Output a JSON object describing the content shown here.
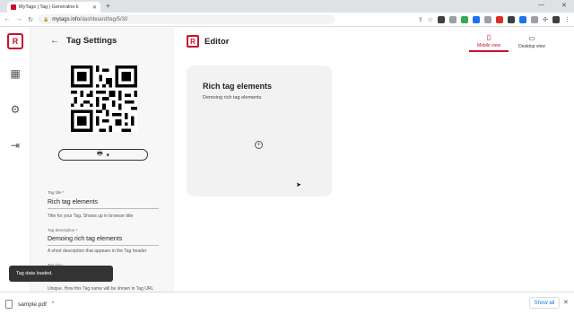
{
  "browser": {
    "tab_title": "MyTags | Tag | Generalne k",
    "new_tab": "+",
    "url_host": "mytags.info",
    "url_path": "/dashboard/tag/5/30",
    "back": "←",
    "forward": "→",
    "reload": "↻",
    "lock": "🔒",
    "minimize": "—",
    "close": "✕"
  },
  "rail": {
    "logo_glyph": "R",
    "icons": [
      "grid-icon",
      "gear-icon",
      "logout-icon"
    ]
  },
  "settings": {
    "back_arrow": "←",
    "heading": "Tag Settings",
    "print_glyph": "🖶",
    "print_caret": "▾",
    "fields": [
      {
        "label": "Tag title *",
        "value": "Rich tag elements",
        "help": "Title for your Tag. Shows up in browser title"
      },
      {
        "label": "Tag description *",
        "value": "Demoing rich tag elements",
        "help": "A short description that appears in the Tag header"
      },
      {
        "label": "Tag slug",
        "value": "",
        "help": "Unique. How this Tag name will be shown in Tag URL"
      }
    ]
  },
  "editor": {
    "logo_glyph": "R",
    "title": "Editor",
    "mobile_view": "Mobile view",
    "desktop_view": "Desktop view",
    "card_title": "Rich tag elements",
    "card_desc": "Demoing rich tag elements",
    "add_glyph": "+"
  },
  "toast": {
    "text": "Tag data loaded."
  },
  "downloads": {
    "file_name": "sample.pdf",
    "caret": "^",
    "show_all": "Show all",
    "close": "✕"
  },
  "colors": {
    "accent": "#c8102e",
    "panel_bg": "#f7f7f7",
    "card_bg": "#f2f2f2",
    "toast_bg": "#333333"
  }
}
